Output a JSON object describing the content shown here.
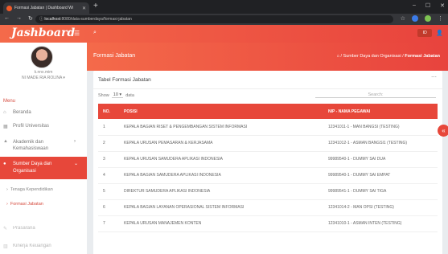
{
  "browser": {
    "tab_title": "Formasi Jabatan | Dashboard Wi",
    "new_tab": "+",
    "url_host": "localhost",
    "url_rest": ":8080/data-sumberdaya/formasi-jabatan"
  },
  "header": {
    "brand": "Jashboard",
    "lang": "ID"
  },
  "sidebar": {
    "user_name": "k.nnx.mim",
    "user_role": "NI MADE RIA ROLINA",
    "menu_title": "Menu",
    "items": [
      {
        "label": "Beranda",
        "icon": "home-icon"
      },
      {
        "label": "Profil Universitas",
        "icon": "building-icon"
      },
      {
        "label": "Akademik dan Kemahasiswaan",
        "icon": "graduation-icon"
      },
      {
        "label": "Sumber Daya dan Organisasi",
        "icon": "users-icon"
      }
    ],
    "subitems": [
      {
        "label": "Tenaga Kependidikan"
      },
      {
        "label": "Formasi Jabatan"
      }
    ],
    "extra_items": [
      {
        "label": "Prasarana"
      },
      {
        "label": "Kinerja Keuangan"
      }
    ]
  },
  "page": {
    "title": "Formasi Jabatan",
    "breadcrumb_mid": "Sumber Daya dan Organisasi",
    "breadcrumb_current": "Formasi Jabatan",
    "card_title": "Tabel Formasi Jabatan",
    "show_label": "Show",
    "show_value": "10",
    "data_label": "data",
    "search_label": "Search:"
  },
  "table": {
    "headers": [
      "NO.",
      "POSISI",
      "NIP - NAMA PEGAWAI"
    ],
    "rows": [
      [
        "1",
        "KEPALA BAGIAN RISET & PENGEMBANGAN SISTEM INFORMASI",
        "12341011-1 - MAN BANGSI (TESTING)"
      ],
      [
        "2",
        "KEPALA URUSAN PEMASARAN & KERJASAMA",
        "12341012-1 - ASMAN BANGSI1 (TESTING)"
      ],
      [
        "3",
        "KEPALA URUSAN SAMUDERA APLIKASI INDONESIA",
        "99989540-1 - DUMMY SAI DUA"
      ],
      [
        "4",
        "KEPALA BAGIAN SAMUDERA APLIKASI INDONESIA",
        "99989540-1 - DUMMY SAI EMPAT"
      ],
      [
        "5",
        "DIREKTUR SAMUDERA APLIKASI INDONESIA",
        "99989541-1 - DUMMY SAI TIGA"
      ],
      [
        "6",
        "KEPALA BAGIAN LAYANAN OPERASIONAL SISTEM INFORMASI",
        "12341014-2 - MAN OPSI (TESTING)"
      ],
      [
        "7",
        "KEPALA URUSAN MANAJEMEN KONTEN",
        "12341010-1 - ASMAN INTEN (TESTING)"
      ]
    ]
  },
  "colors": {
    "accent": "#e7473a",
    "header_gradient_start": "#f46a4a"
  }
}
